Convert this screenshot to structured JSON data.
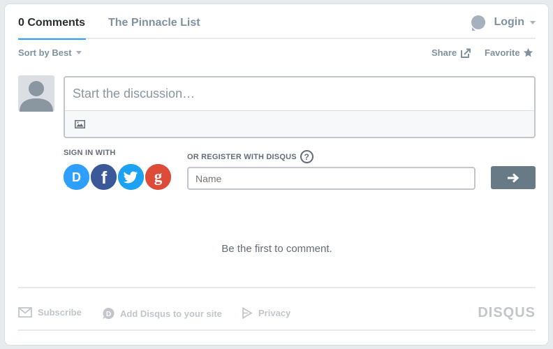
{
  "nav": {
    "comments_tab": "0 Comments",
    "site_tab": "The Pinnacle List",
    "login": "Login"
  },
  "toolbar": {
    "sort": "Sort by Best",
    "share": "Share",
    "favorite": "Favorite"
  },
  "composer": {
    "placeholder": "Start the discussion…"
  },
  "signin": {
    "label": "SIGN IN WITH",
    "providers": [
      {
        "name": "Disqus",
        "glyph": "D",
        "color": "#2e9fff"
      },
      {
        "name": "Facebook",
        "glyph": "f",
        "color": "#3b5998"
      },
      {
        "name": "Twitter",
        "glyph": "twitter-bird",
        "color": "#1da1f2"
      },
      {
        "name": "Google",
        "glyph": "g",
        "color": "#dd4b39"
      }
    ]
  },
  "register": {
    "label": "OR REGISTER WITH DISQUS",
    "help": "?",
    "name_placeholder": "Name"
  },
  "empty_message": "Be the first to comment.",
  "footer": {
    "subscribe": "Subscribe",
    "add_disqus": "Add Disqus to your site",
    "privacy": "Privacy",
    "brand": "DISQUS"
  }
}
